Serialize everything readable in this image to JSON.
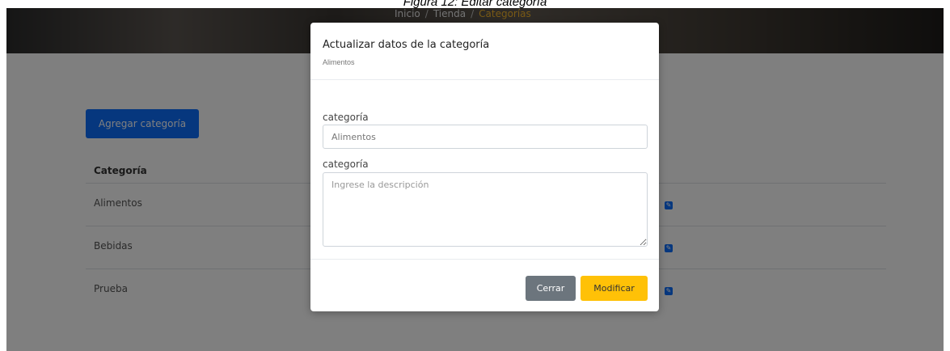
{
  "caption": "Figura 12: Editar categoría",
  "breadcrumb": {
    "home": "Inicio",
    "store": "Tienda",
    "current": "Categorías"
  },
  "page": {
    "add_button": "Agregar categoría",
    "table_header": "Categoría",
    "rows": [
      "Alimentos",
      "Bebidas",
      "Prueba"
    ]
  },
  "modal": {
    "title": "Actualizar datos de la categoría",
    "subtitle": "Alimentos",
    "field1_label": "categoría",
    "field1_value": "Alimentos",
    "field2_label": "categoría",
    "field2_placeholder": "Ingrese la descripción",
    "close_button": "Cerrar",
    "modify_button": "Modificar"
  },
  "colors": {
    "primary": "#0d6efd",
    "secondary": "#6c757d",
    "warning": "#ffc107",
    "backdrop": "rgba(0,0,0,0.5)"
  },
  "icons": {
    "edit": "edit-icon"
  }
}
